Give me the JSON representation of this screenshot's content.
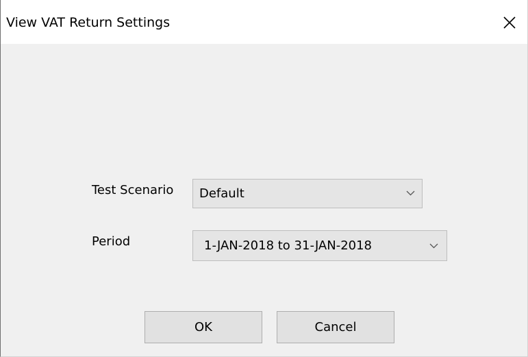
{
  "dialog": {
    "title": "View VAT Return Settings",
    "close_icon": "close-icon"
  },
  "form": {
    "test_scenario": {
      "label": "Test Scenario",
      "selected": "Default",
      "dropdown_icon": "chevron-down-icon"
    },
    "period": {
      "label": "Period",
      "selected": "1-JAN-2018 to 31-JAN-2018",
      "dropdown_icon": "chevron-down-icon"
    }
  },
  "buttons": {
    "ok_label": "OK",
    "cancel_label": "Cancel"
  },
  "colors": {
    "dialog_background": "#f0f0f0",
    "titlebar_background": "#ffffff",
    "control_background": "#e5e5e5",
    "button_background": "#e1e1e1"
  }
}
